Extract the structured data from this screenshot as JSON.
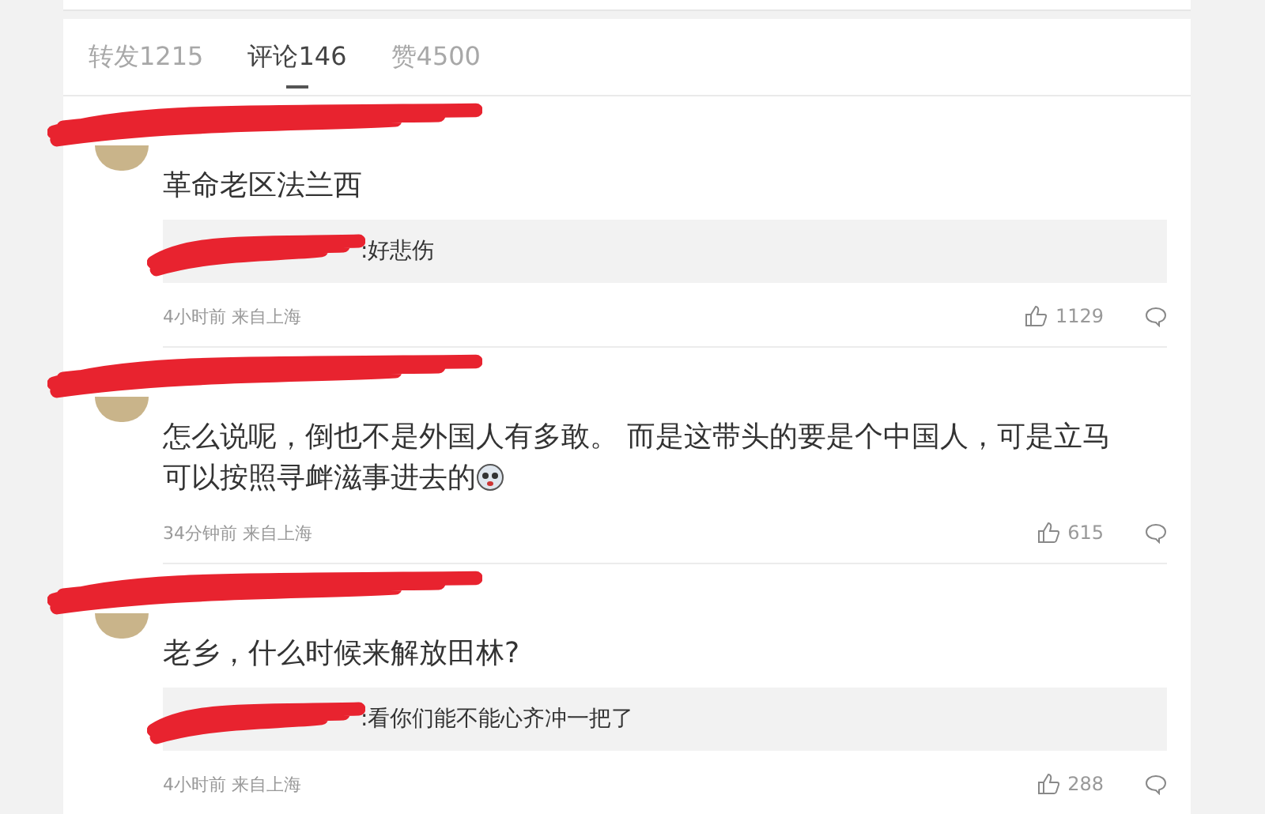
{
  "tabs": [
    {
      "label": "转发1215",
      "selected": false
    },
    {
      "label": "评论146",
      "selected": true
    },
    {
      "label": "赞4500",
      "selected": false
    }
  ],
  "comments": [
    {
      "author_redacted": true,
      "text": "革命老区法兰西",
      "emoji": false,
      "reply": {
        "author_redacted": true,
        "text": ":好悲伤"
      },
      "time": "4小时前 来自上海",
      "likes": "1129"
    },
    {
      "author_redacted": true,
      "text": "怎么说呢，倒也不是外国人有多敢。 而是这带头的要是个中国人，可是立马可以按照寻衅滋事进去的",
      "emoji": true,
      "time": "34分钟前 来自上海",
      "likes": "615"
    },
    {
      "author_redacted": true,
      "text": "老乡，什么时候来解放田林?",
      "emoji": false,
      "reply": {
        "author_redacted": true,
        "text": ":看你们能不能心齐冲一把了"
      },
      "time": "4小时前 来自上海",
      "likes": "288"
    }
  ]
}
